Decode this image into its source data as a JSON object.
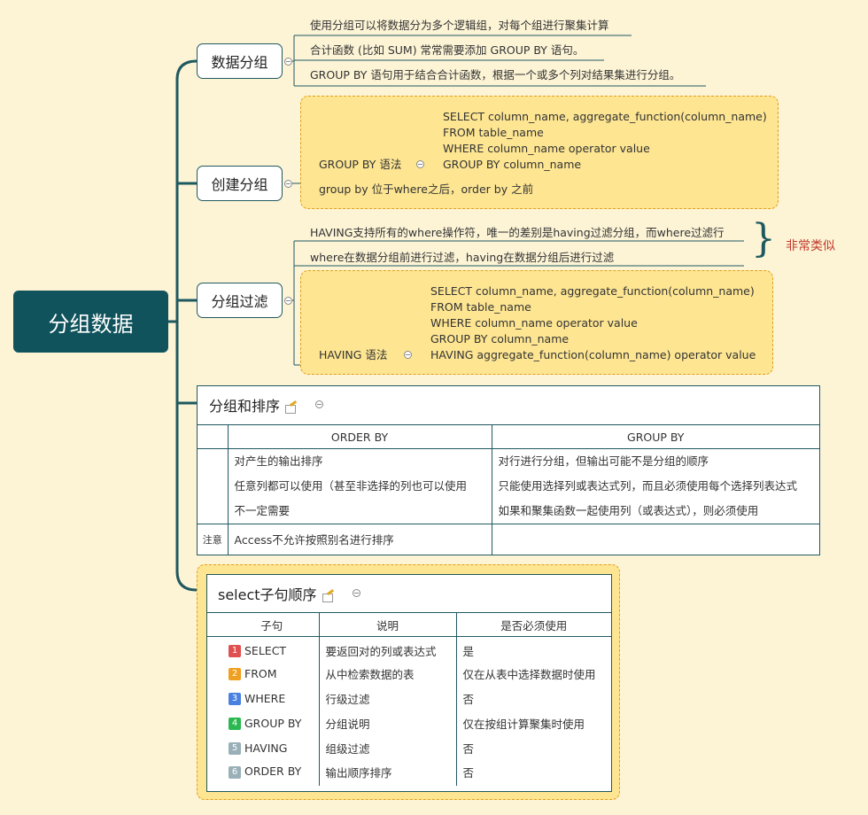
{
  "root": {
    "label": "分组数据"
  },
  "topics": {
    "data_grouping": {
      "label": "数据分组",
      "leaves": [
        "使用分组可以将数据分为多个逻辑组，对每个组进行聚集计算",
        "合计函数 (比如 SUM) 常常需要添加 GROUP BY 语句。",
        "GROUP BY 语句用于结合合计函数，根据一个或多个列对结果集进行分组。"
      ]
    },
    "create_group": {
      "label": "创建分组",
      "syntax_label": "GROUP BY 语法",
      "code": [
        "SELECT column_name, aggregate_function(column_name)",
        "FROM table_name",
        "WHERE column_name operator value",
        "GROUP BY column_name"
      ],
      "note": "group by 位于where之后，order by 之前"
    },
    "filter_group": {
      "label": "分组过滤",
      "leaves": [
        "HAVING支持所有的where操作符，唯一的差别是having过滤分组，而where过滤行",
        "where在数据分组前进行过滤，having在数据分组后进行过滤"
      ],
      "brace_note": "非常类似",
      "syntax_label": "HAVING 语法",
      "code": [
        "SELECT column_name, aggregate_function(column_name)",
        "FROM table_name",
        "WHERE column_name operator value",
        "GROUP BY column_name",
        "HAVING aggregate_function(column_name) operator value"
      ]
    },
    "group_sort": {
      "label": "分组和排序",
      "headers": [
        "ORDER BY",
        "GROUP BY"
      ],
      "order_by": [
        "对产生的输出排序",
        "任意列都可以使用（甚至非选择的列也可以使用",
        "不一定需要"
      ],
      "group_by": [
        "对行进行分组，但输出可能不是分组的顺序",
        "只能使用选择列或表达式列，而且必须使用每个选择列表达式",
        "如果和聚集函数一起使用列（或表达式），则必须使用"
      ],
      "note_label": "注意",
      "note_text": "Access不允许按照别名进行排序"
    },
    "select_order": {
      "label": "select子句顺序",
      "headers": [
        "子句",
        "说明",
        "是否必须使用"
      ],
      "rows": [
        {
          "num": "1",
          "color": "#e05050",
          "clause": "SELECT",
          "desc": "要返回对的列或表达式",
          "required": "是"
        },
        {
          "num": "2",
          "color": "#f0a020",
          "clause": "FROM",
          "desc": "从中检索数据的表",
          "required": "仅在从表中选择数据时使用"
        },
        {
          "num": "3",
          "color": "#4a80e0",
          "clause": "WHERE",
          "desc": "行级过滤",
          "required": "否"
        },
        {
          "num": "4",
          "color": "#2cb850",
          "clause": "GROUP BY",
          "desc": "分组说明",
          "required": "仅在按组计算聚集时使用"
        },
        {
          "num": "5",
          "color": "#9ab0b8",
          "clause": "HAVING",
          "desc": "组级过滤",
          "required": "否"
        },
        {
          "num": "6",
          "color": "#9ab0b8",
          "clause": "ORDER BY",
          "desc": "输出顺序排序",
          "required": "否"
        }
      ]
    }
  }
}
